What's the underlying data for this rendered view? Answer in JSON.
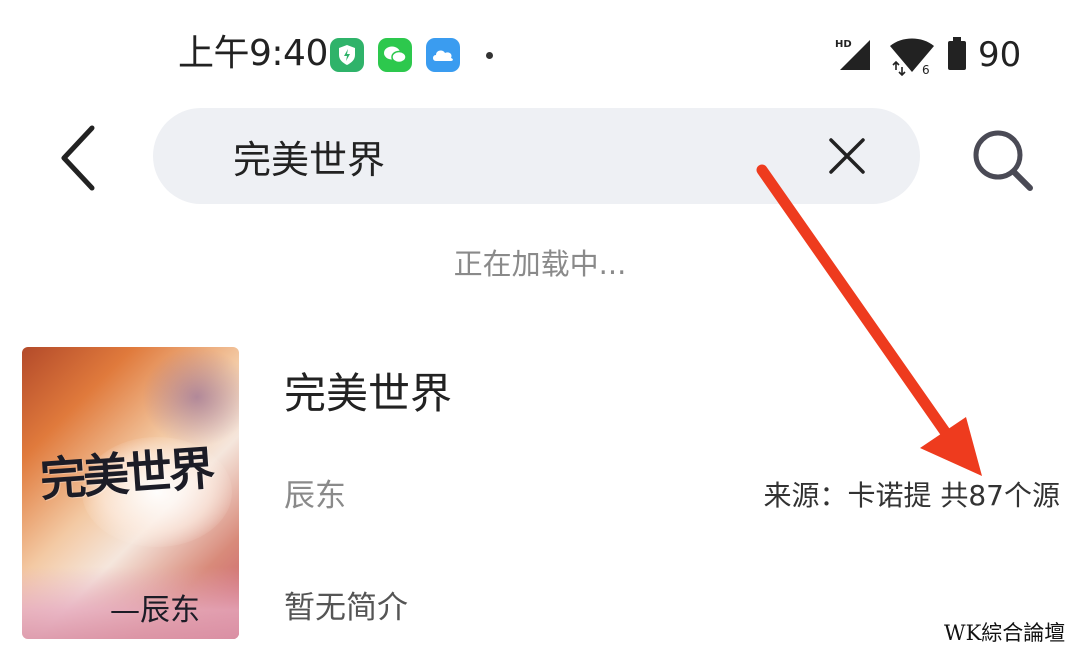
{
  "status_bar": {
    "time": "上午9:40",
    "battery": "90",
    "network_type": "6",
    "network_label": "HD",
    "icons": [
      "security-shield-icon",
      "wechat-icon",
      "cloud-icon",
      "dot-icon",
      "hd-signal-icon",
      "wifi-icon",
      "battery-icon"
    ],
    "colors": {
      "shield": "#2fb36a",
      "wechat": "#2dc84d",
      "cloud": "#3a9cf0"
    }
  },
  "search": {
    "query": "完美世界",
    "back_icon": "chevron-left-icon",
    "clear_icon": "close-icon",
    "search_icon": "search-icon"
  },
  "loading_text": "正在加载中...",
  "results": [
    {
      "title": "完美世界",
      "author": "辰东",
      "source": "来源：卡诺提 共87个源",
      "intro": "暂无简介",
      "cover": {
        "title": "完美世界",
        "author": "—辰东"
      }
    }
  ],
  "annotation": {
    "arrow_color": "#ee3b1e"
  },
  "watermark": "WK綜合論壇"
}
